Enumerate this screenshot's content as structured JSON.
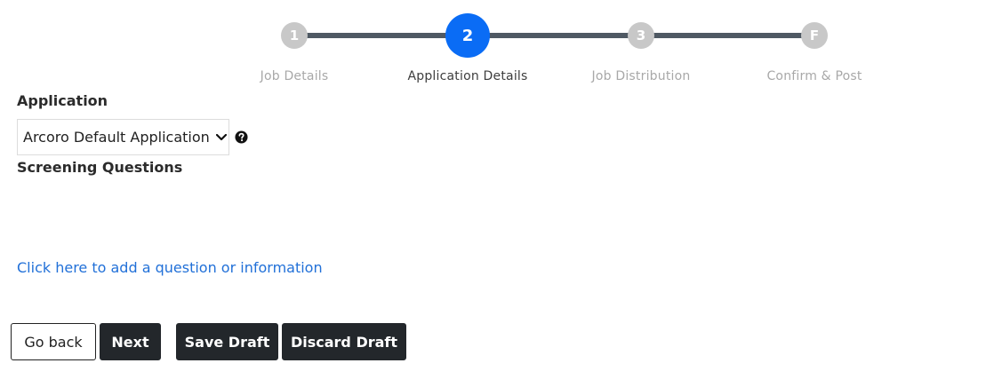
{
  "stepper": {
    "steps": [
      {
        "badge": "1",
        "label": "Job Details",
        "active": false
      },
      {
        "badge": "2",
        "label": "Application Details",
        "active": true
      },
      {
        "badge": "3",
        "label": "Job Distribution",
        "active": false
      },
      {
        "badge": "F",
        "label": "Confirm & Post",
        "active": false
      }
    ],
    "colors": {
      "active": "#0a6cf5",
      "inactive": "#c8c8c8",
      "line": "#4f5963"
    }
  },
  "application": {
    "heading": "Application",
    "select_value": "Arcoro Default Application",
    "select_icon": "chevron-down-icon",
    "help_icon": "question-circle-icon"
  },
  "screening": {
    "heading": "Screening Questions",
    "add_link": "Click here to add a question or information",
    "link_color": "#2170d8"
  },
  "actions": {
    "go_back": "Go back",
    "next": "Next",
    "save_draft": "Save Draft",
    "discard_draft": "Discard Draft"
  }
}
